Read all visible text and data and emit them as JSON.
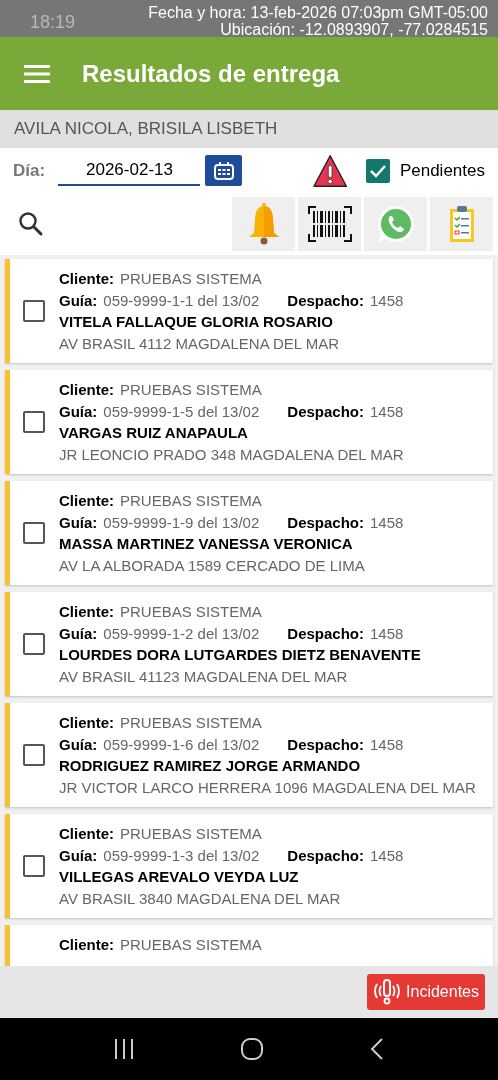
{
  "status_bar": {
    "time": "18:19",
    "datetime": "Fecha y hora: 13-feb-2026 07:03pm GMT-05:00",
    "location": "Ubicación: -12.0893907, -77.0284515"
  },
  "app_bar": {
    "title": "Resultados de entrega"
  },
  "user": "AVILA NICOLA, BRISILA LISBETH",
  "filter": {
    "day_label": "Día:",
    "date": "2026-02-13",
    "pending": {
      "label": "Pendientes",
      "checked": true
    }
  },
  "deliveries": [
    {
      "checked": false,
      "client_label": "Cliente:",
      "client": "PRUEBAS SISTEMA",
      "guide_label": "Guía:",
      "guide": "059-9999-1-1 del 13/02",
      "dispatch_label": "Despacho:",
      "dispatch": "1458",
      "name": "VITELA FALLAQUE GLORIA ROSARIO",
      "address": "AV BRASIL 4112 MAGDALENA DEL MAR"
    },
    {
      "checked": false,
      "client_label": "Cliente:",
      "client": "PRUEBAS SISTEMA",
      "guide_label": "Guía:",
      "guide": "059-9999-1-5 del 13/02",
      "dispatch_label": "Despacho:",
      "dispatch": "1458",
      "name": "VARGAS RUIZ ANAPAULA",
      "address": "JR LEONCIO PRADO 348 MAGDALENA DEL MAR"
    },
    {
      "checked": false,
      "client_label": "Cliente:",
      "client": "PRUEBAS SISTEMA",
      "guide_label": "Guía:",
      "guide": "059-9999-1-9 del 13/02",
      "dispatch_label": "Despacho:",
      "dispatch": "1458",
      "name": "MASSA MARTINEZ VANESSA VERONICA",
      "address": "AV LA ALBORADA 1589 CERCADO DE LIMA"
    },
    {
      "checked": false,
      "client_label": "Cliente:",
      "client": "PRUEBAS SISTEMA",
      "guide_label": "Guía:",
      "guide": "059-9999-1-2 del 13/02",
      "dispatch_label": "Despacho:",
      "dispatch": "1458",
      "name": "LOURDES DORA LUTGARDES DIETZ BENAVENTE",
      "address": "AV BRASIL 41123 MAGDALENA DEL MAR"
    },
    {
      "checked": false,
      "client_label": "Cliente:",
      "client": "PRUEBAS SISTEMA",
      "guide_label": "Guía:",
      "guide": "059-9999-1-6 del 13/02",
      "dispatch_label": "Despacho:",
      "dispatch": "1458",
      "name": "RODRIGUEZ RAMIREZ JORGE ARMANDO",
      "address": "JR VICTOR LARCO HERRERA 1096 MAGDALENA DEL MAR"
    },
    {
      "checked": false,
      "client_label": "Cliente:",
      "client": "PRUEBAS SISTEMA",
      "guide_label": "Guía:",
      "guide": "059-9999-1-3 del 13/02",
      "dispatch_label": "Despacho:",
      "dispatch": "1458",
      "name": "VILLEGAS AREVALO VEYDA LUZ",
      "address": "AV BRASIL 3840 MAGDALENA DEL MAR"
    },
    {
      "client_label": "Cliente:",
      "client": "PRUEBAS SISTEMA"
    }
  ],
  "incidents_button": "Incidentes"
}
